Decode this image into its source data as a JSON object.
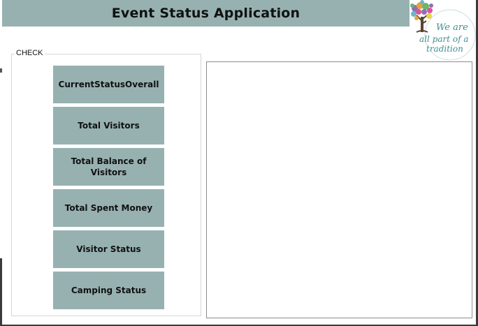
{
  "header": {
    "title": "Event Status Application"
  },
  "logo": {
    "icon": "tree-icon",
    "lines": [
      "We are",
      "all part of a",
      "tradition"
    ]
  },
  "check_group": {
    "label": "CHECK",
    "buttons": [
      {
        "label": "CurrentStatusOverall"
      },
      {
        "label": "Total Visitors"
      },
      {
        "label": "Total Balance of Visitors"
      },
      {
        "label": "Total Spent Money"
      },
      {
        "label": "Visitor Status"
      },
      {
        "label": "Camping Status"
      }
    ]
  },
  "colors": {
    "accent": "#97b1b1",
    "logo_text": "#3f8f93"
  }
}
